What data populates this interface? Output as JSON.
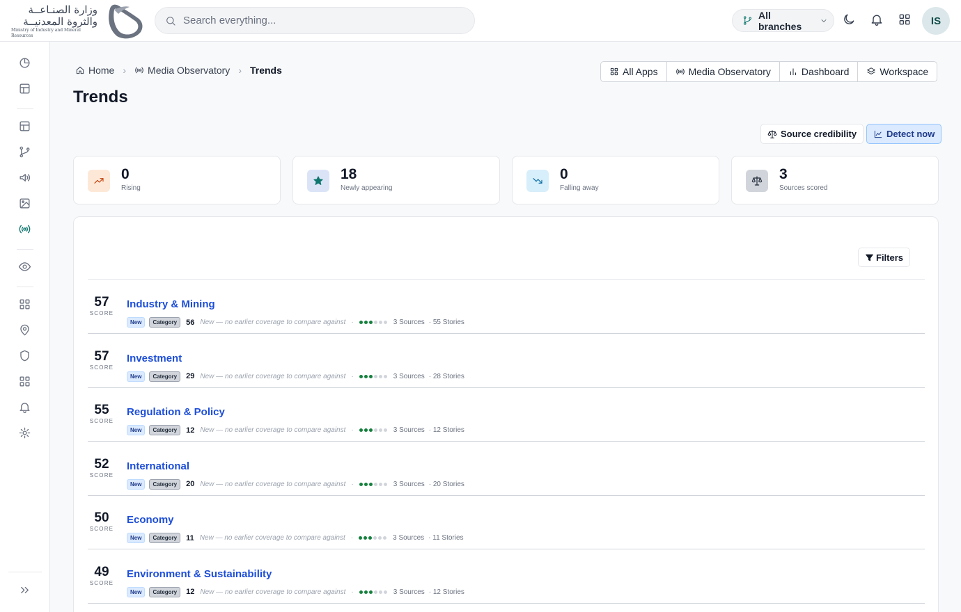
{
  "header": {
    "logo_ar_line1": "وزارة الصنـاعــة",
    "logo_ar_line2": "والثروة المعدنيــة",
    "logo_en": "Ministry of Industry and Mineral Resources",
    "search_placeholder": "Search everything...",
    "branch_label": "All branches",
    "avatar_initials": "IS"
  },
  "breadcrumb": {
    "home": "Home",
    "section": "Media Observatory",
    "current": "Trends",
    "separator": "›"
  },
  "app_nav": {
    "all_apps": "All Apps",
    "media_observatory": "Media Observatory",
    "dashboard": "Dashboard",
    "workspace": "Workspace"
  },
  "page": {
    "title": "Trends",
    "source_credibility_label": "Source credibility",
    "detect_now_label": "Detect now",
    "filters_label": "Filters"
  },
  "stats": [
    {
      "value": "0",
      "label": "Rising",
      "icon": "trending-up-icon",
      "bg": "#fde8d7",
      "fg": "#c2410c"
    },
    {
      "value": "18",
      "label": "Newly appearing",
      "icon": "star-icon",
      "bg": "#dbe4f7",
      "fg": "#0f766e"
    },
    {
      "value": "0",
      "label": "Falling away",
      "icon": "trending-down-icon",
      "bg": "#d7eefb",
      "fg": "#0369a1"
    },
    {
      "value": "3",
      "label": "Sources scored",
      "icon": "scale-icon",
      "bg": "#d1d5db",
      "fg": "#1f2937"
    }
  ],
  "score_caption": "SCORE",
  "trends": [
    {
      "score": "57",
      "name": "Industry & Mining",
      "tag_new": "New",
      "tag_category": "Category",
      "count": "56",
      "note": "New — no earlier coverage to compare against",
      "credibility_level": 3,
      "credibility_max": 6,
      "sources": "3 Sources",
      "stories": "· 55 Stories"
    },
    {
      "score": "57",
      "name": "Investment",
      "tag_new": "New",
      "tag_category": "Category",
      "count": "29",
      "note": "New — no earlier coverage to compare against",
      "credibility_level": 3,
      "credibility_max": 6,
      "sources": "3 Sources",
      "stories": "· 28 Stories"
    },
    {
      "score": "55",
      "name": "Regulation & Policy",
      "tag_new": "New",
      "tag_category": "Category",
      "count": "12",
      "note": "New — no earlier coverage to compare against",
      "credibility_level": 3,
      "credibility_max": 6,
      "sources": "3 Sources",
      "stories": "· 12 Stories"
    },
    {
      "score": "52",
      "name": "International",
      "tag_new": "New",
      "tag_category": "Category",
      "count": "20",
      "note": "New — no earlier coverage to compare against",
      "credibility_level": 3,
      "credibility_max": 6,
      "sources": "3 Sources",
      "stories": "· 20 Stories"
    },
    {
      "score": "50",
      "name": "Economy",
      "tag_new": "New",
      "tag_category": "Category",
      "count": "11",
      "note": "New — no earlier coverage to compare against",
      "credibility_level": 3,
      "credibility_max": 6,
      "sources": "3 Sources",
      "stories": "· 11 Stories"
    },
    {
      "score": "49",
      "name": "Environment & Sustainability",
      "tag_new": "New",
      "tag_category": "Category",
      "count": "12",
      "note": "New — no earlier coverage to compare against",
      "credibility_level": 3,
      "credibility_max": 6,
      "sources": "3 Sources",
      "stories": "· 12 Stories"
    }
  ],
  "colors": {
    "accent": "#0f766e",
    "link": "#1d4ed8",
    "credibility_on": "#15803d"
  }
}
